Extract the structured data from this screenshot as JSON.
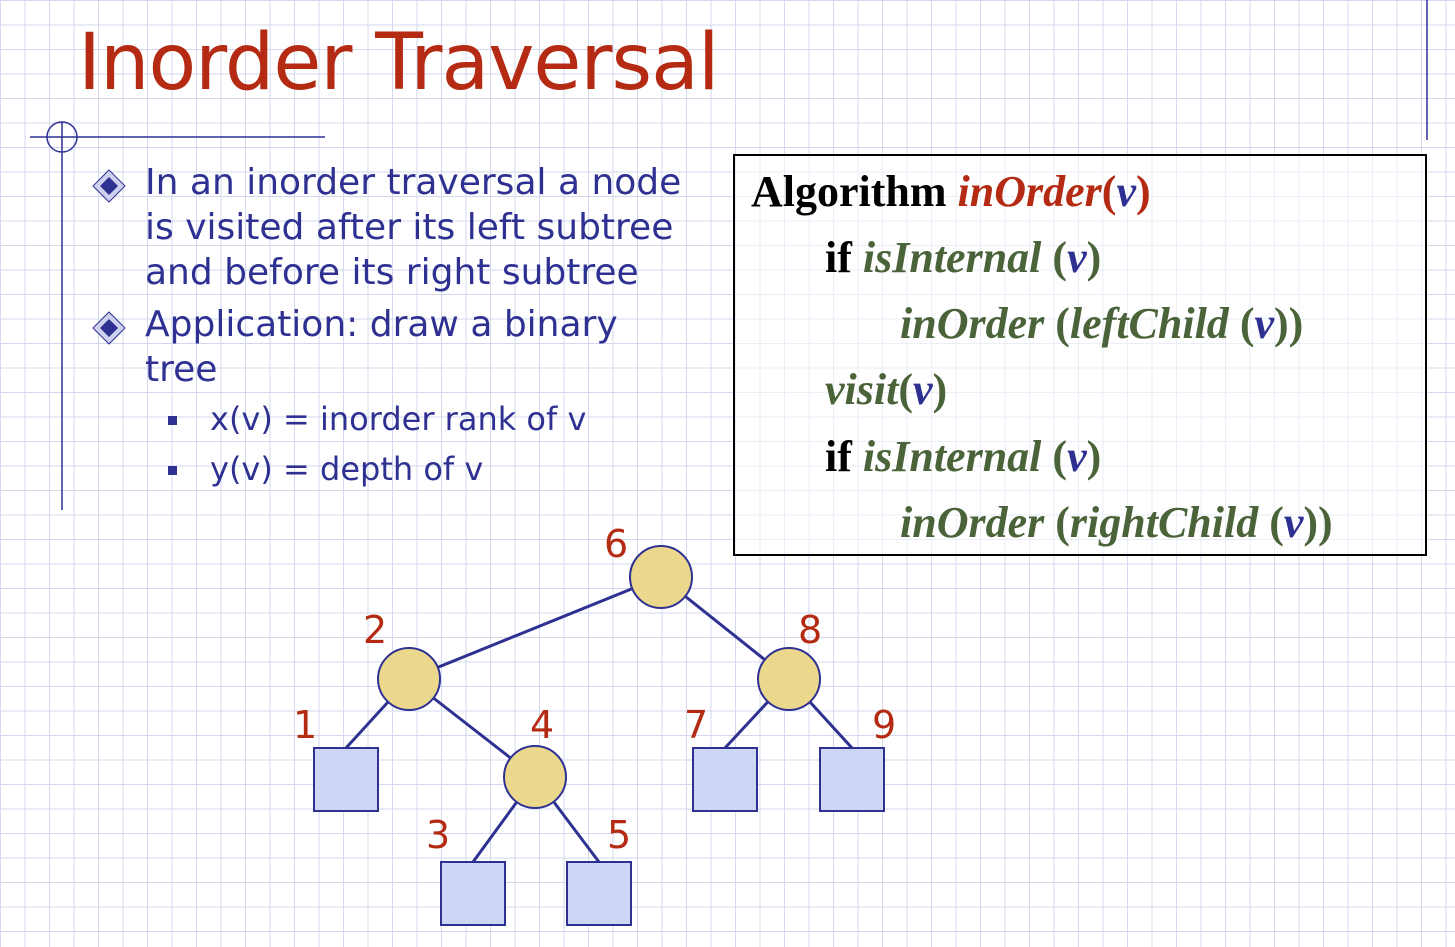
{
  "slide": {
    "title": "Inorder Traversal",
    "bullets": [
      {
        "text": "In an inorder traversal a node is visited after its left subtree and before its right subtree"
      },
      {
        "text": "Application: draw a binary tree",
        "sub": [
          "x(v) = inorder rank of v",
          "y(v) = depth of v"
        ]
      }
    ]
  },
  "algorithm": {
    "keyword": "Algorithm",
    "name": "inOrder",
    "param": "v",
    "lines": {
      "if1_kw": "if",
      "if1_fn": "isInternal",
      "call1_fn": "inOrder",
      "call1_inner": "leftChild",
      "visit_fn": "visit",
      "if2_kw": "if",
      "if2_fn": "isInternal",
      "call2_fn": "inOrder",
      "call2_inner": "rightChild"
    }
  },
  "tree": {
    "internal_labels": [
      "6",
      "2",
      "8",
      "4"
    ],
    "leaf_labels": [
      "1",
      "7",
      "9",
      "3",
      "5"
    ],
    "colors": {
      "internal_fill": "#ecd88c",
      "leaf_fill": "#cdd6f4",
      "stroke": "#2e3192",
      "label": "#b52a12"
    }
  }
}
